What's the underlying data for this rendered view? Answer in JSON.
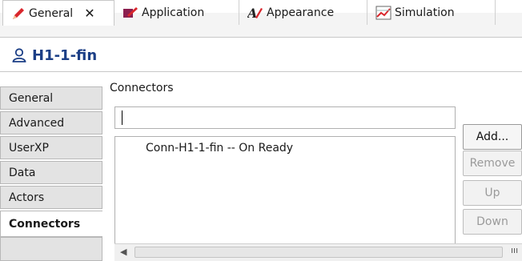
{
  "tabs": [
    {
      "label": "General",
      "icon": "pencil-icon",
      "close": "✕"
    },
    {
      "label": "Application",
      "icon": "application-icon"
    },
    {
      "label": "Appearance",
      "icon": "appearance-icon"
    },
    {
      "label": "Simulation",
      "icon": "simulation-icon"
    }
  ],
  "header": {
    "title": "H1-1-fin",
    "icon": "user-icon"
  },
  "sidebar": {
    "items": [
      {
        "label": "General"
      },
      {
        "label": "Advanced"
      },
      {
        "label": "UserXP"
      },
      {
        "label": "Data"
      },
      {
        "label": "Actors"
      },
      {
        "label": "Connectors"
      }
    ],
    "selected": "Connectors"
  },
  "main": {
    "section_title": "Connectors",
    "input_value": "",
    "list": [
      "Conn-H1-1-fin -- On Ready"
    ],
    "buttons": {
      "add": "Add...",
      "remove": "Remove",
      "up": "Up",
      "down": "Down"
    }
  },
  "colors": {
    "accent": "#1c3f86",
    "tab_red": "#d9262c",
    "disabled_text": "#9a9a9a"
  }
}
